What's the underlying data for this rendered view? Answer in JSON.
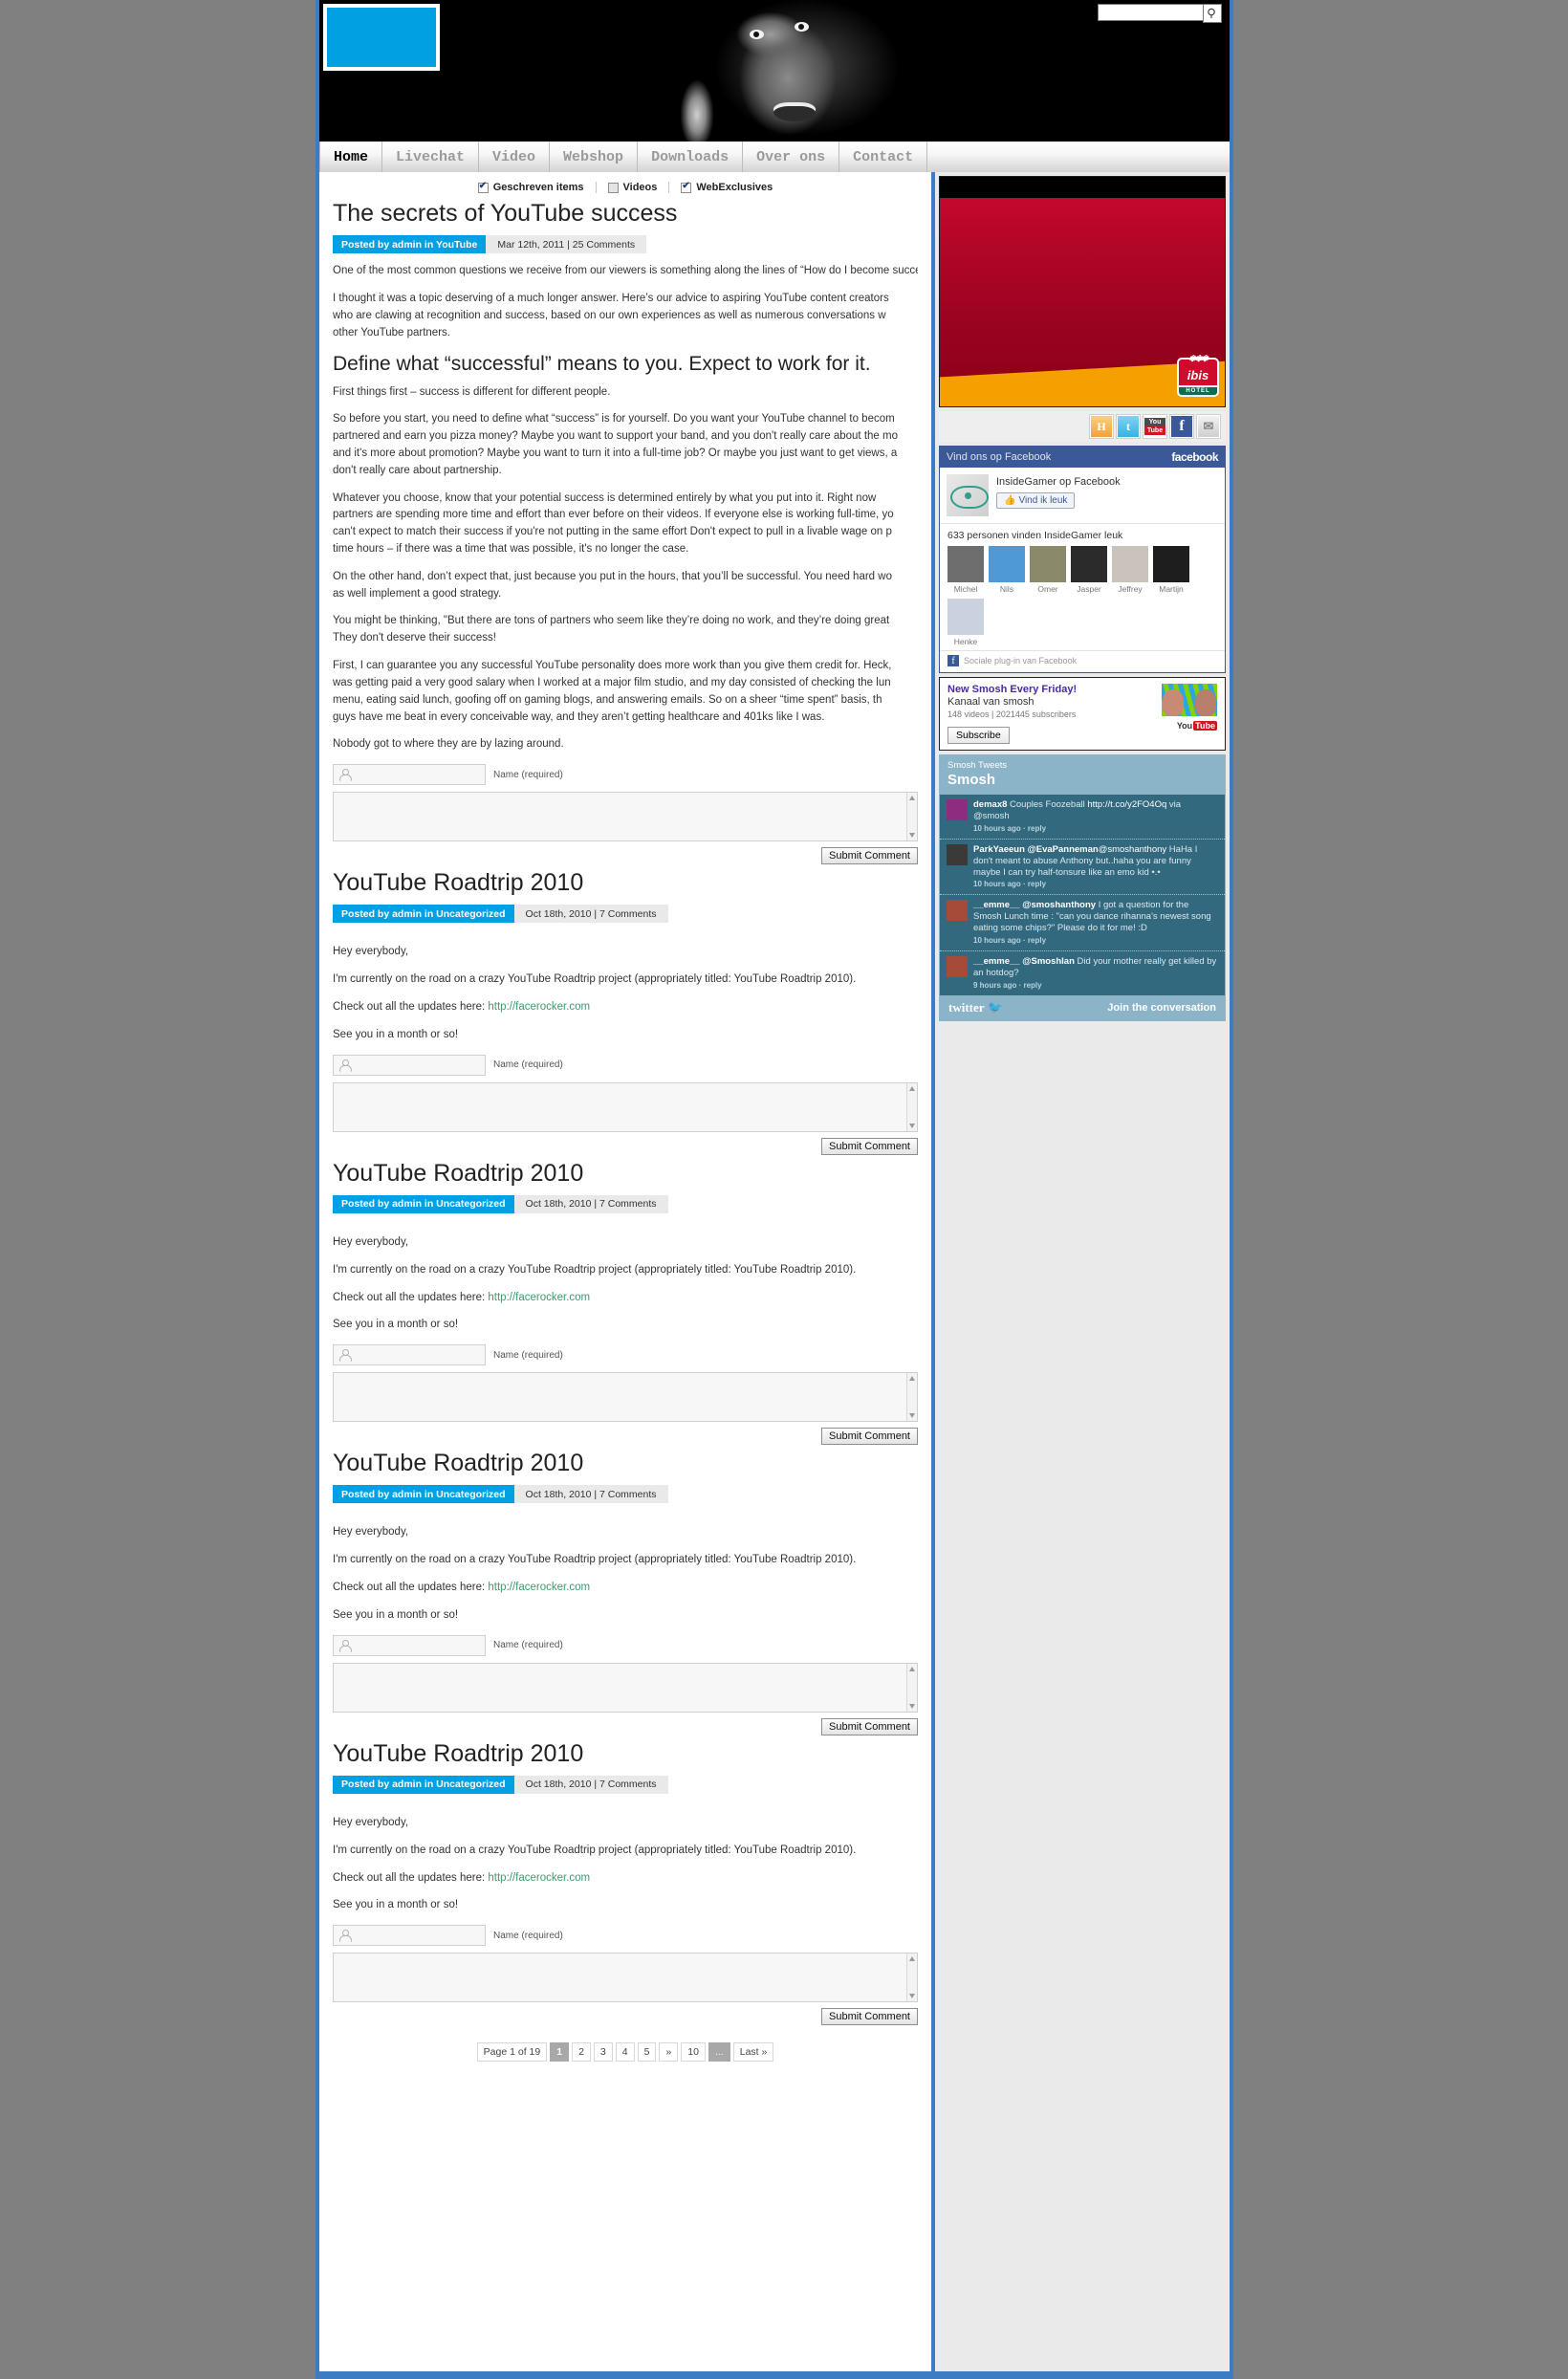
{
  "header": {
    "logo_alt": "site-logo",
    "search_placeholder": "",
    "search_value": "",
    "search_icon": "search-icon"
  },
  "nav": {
    "items": [
      {
        "label": "Home",
        "active": true
      },
      {
        "label": "Livechat",
        "active": false
      },
      {
        "label": "Video",
        "active": false
      },
      {
        "label": "Webshop",
        "active": false
      },
      {
        "label": "Downloads",
        "active": false
      },
      {
        "label": "Over ons",
        "active": false
      },
      {
        "label": "Contact",
        "active": false
      }
    ]
  },
  "filters": [
    {
      "label": "Geschreven items",
      "checked": true
    },
    {
      "label": "Videos",
      "checked": false
    },
    {
      "label": "WebExclusives",
      "checked": true
    }
  ],
  "posts": [
    {
      "title": "The secrets of YouTube success",
      "category": "Posted by admin in YouTube",
      "date": "Mar 12th, 2011 | 25 Comments",
      "p1": "One of the most common questions we receive from our viewers is something along the lines of “How do I become successful on YouTube?”",
      "p1b": "successful on YouTube?”",
      "p2": "I thought it was a topic deserving of a much longer answer. Here’s our advice to aspiring YouTube content creators",
      "p2b": "who are clawing at recognition and success, based on our own experiences as well as numerous conversations w",
      "p2c": "other YouTube partners.",
      "subhead": "Define what “successful” means to you. Expect to work for it.",
      "p3": "First things first – success is different for different people.",
      "p4a": "So before you start, you need to define what “success” is for yourself. Do you want your YouTube channel to becom",
      "p4b": "partnered and earn you pizza money? Maybe you want to support your band, and you don't really care about the mo",
      "p4c": "and it's more about promotion? Maybe you want to turn it into a full-time job? Or maybe you just want to get views, a",
      "p4d": "don't really care about partnership.",
      "p5a": "Whatever you choose, know that your potential success is determined entirely by what you put into it. Right now",
      "p5b": "partners are spending more time and effort than ever before on their videos. If everyone else is working full-time, yo",
      "p5c": "can't expect to match their success if you're not putting in the same effort Don't expect to pull in a livable wage on p",
      "p5d": "time hours – if there was a time that was possible, it's no longer the case.",
      "p6a": "On the other hand, don’t expect that, just because you put in the hours, that you’ll be successful. You need hard wo",
      "p6b": "as well implement a good strategy.",
      "p7a": "You might be thinking, \"But there are tons of partners who seem like they’re doing no work, and they’re doing great",
      "p7b": "They don't deserve their success!",
      "p8a": "First, I can guarantee you any successful YouTube personality does more work than you give them credit for. Heck,",
      "p8b": "was getting paid a very good salary when I worked at a major film studio, and my day consisted of checking the lun",
      "p8c": "menu, eating said lunch, goofing off on gaming blogs, and answering emails. So on a sheer “time spent” basis, th",
      "p8d": "guys have me beat in every conceivable way, and they aren’t getting healthcare and 401ks like I was.",
      "p9": "Nobody got to where they are by lazing around."
    },
    {
      "title": "YouTube Roadtrip 2010",
      "category": "Posted by admin in Uncategorized",
      "date": "Oct 18th, 2010 | 7 Comments",
      "l1": "Hey everybody,",
      "l2": "I'm currently on the road on a crazy YouTube Roadtrip project (appropriately titled: YouTube Roadtrip 2010).",
      "l3_pre": "Check out all the updates here: ",
      "l3_link": "http://facerocker.com",
      "l4": "See you in a month or so!"
    },
    {
      "title": "YouTube Roadtrip 2010",
      "category": "Posted by admin in Uncategorized",
      "date": "Oct 18th, 2010 | 7 Comments",
      "l1": "Hey everybody,",
      "l2": "I'm currently on the road on a crazy YouTube Roadtrip project (appropriately titled: YouTube Roadtrip 2010).",
      "l3_pre": "Check out all the updates here: ",
      "l3_link": "http://facerocker.com",
      "l4": "See you in a month or so!"
    },
    {
      "title": "YouTube Roadtrip 2010",
      "category": "Posted by admin in Uncategorized",
      "date": "Oct 18th, 2010 | 7 Comments",
      "l1": "Hey everybody,",
      "l2": "I'm currently on the road on a crazy YouTube Roadtrip project (appropriately titled: YouTube Roadtrip 2010).",
      "l3_pre": "Check out all the updates here: ",
      "l3_link": "http://facerocker.com",
      "l4": "See you in a month or so!"
    },
    {
      "title": "YouTube Roadtrip 2010",
      "category": "Posted by admin in Uncategorized",
      "date": "Oct 18th, 2010 | 7 Comments",
      "l1": "Hey everybody,",
      "l2": "I'm currently on the road on a crazy YouTube Roadtrip project (appropriately titled: YouTube Roadtrip 2010).",
      "l3_pre": "Check out all the updates here: ",
      "l3_link": "http://facerocker.com",
      "l4": "See you in a month or so!"
    }
  ],
  "comment_form": {
    "name_placeholder": "",
    "name_label": "Name (required)",
    "comment_value": "",
    "submit_label": "Submit Comment"
  },
  "pagination": {
    "label": "Page 1 of 19",
    "items": [
      "1",
      "2",
      "3",
      "4",
      "5",
      "»",
      "10",
      "...",
      "Last »"
    ],
    "active": "1"
  },
  "sidebar": {
    "ad": {
      "brand": "ibis",
      "sub": "HOTEL"
    },
    "social": [
      {
        "name": "hyves-icon",
        "glyph": "H"
      },
      {
        "name": "twitter-icon",
        "glyph": "t"
      },
      {
        "name": "youtube-icon",
        "glyph": "You Tube"
      },
      {
        "name": "facebook-icon",
        "glyph": "f"
      },
      {
        "name": "email-icon",
        "glyph": "✉"
      }
    ],
    "facebook": {
      "header": "Vind ons op Facebook",
      "logo": "facebook",
      "page_name": "InsideGamer",
      "page_suffix": " op Facebook",
      "like_label": "Vind ik leuk",
      "count_text": "633 personen vinden InsideGamer leuk",
      "people": [
        {
          "name": "Michel",
          "color": "#6e6e6e"
        },
        {
          "name": "Nils",
          "color": "#4f9ad6"
        },
        {
          "name": "Omer",
          "color": "#8a8a6a"
        },
        {
          "name": "Jasper",
          "color": "#2b2b2b"
        },
        {
          "name": "Jeffrey",
          "color": "#c9c3bb"
        },
        {
          "name": "Martijn",
          "color": "#1e1e1e"
        },
        {
          "name": "Henke",
          "color": "#c9d2de"
        }
      ],
      "footer": "Sociale plug-in van Facebook"
    },
    "youtube": {
      "title": "New Smosh Every Friday!",
      "channel": "Kanaal van smosh",
      "stats": "148 videos | 2021445 subscribers",
      "subscribe_label": "Subscribe",
      "logo_a": "You",
      "logo_b": "Tube"
    },
    "twitter": {
      "small": "Smosh Tweets",
      "big": "Smosh",
      "tweets": [
        {
          "user": "demax8",
          "text": " Couples Foozeball ",
          "link": "http://t.co/y2FO4Oq",
          "tail": " via @smosh",
          "ago": "10 hours ago · reply",
          "avatar_color": "#8e2c80"
        },
        {
          "user": "ParkYaeeun @EvaPanneman",
          "text": "",
          "link": "@smoshanthony",
          "tail": " HaHa I don't meant to abuse Anthony but..haha you are funny maybe I can try half-tonsure like an emo kid •.•",
          "ago": "10 hours ago · reply",
          "avatar_color": "#3c3a38"
        },
        {
          "user": "__emme__ @smoshanthony",
          "text": "",
          "link": "",
          "tail": " I got a question for the Smosh Lunch time : \"can you dance rihanna's newest song eating some chips?\" Please do it for me! :D",
          "ago": "10 hours ago · reply",
          "avatar_color": "#a64b3a"
        },
        {
          "user": "__emme__ @SmoshIan",
          "text": "",
          "link": "",
          "tail": " Did your mother really get killed by an hotdog?",
          "ago": "9 hours ago · reply",
          "avatar_color": "#a64b3a"
        }
      ],
      "brand": "twitter",
      "join": "Join the conversation"
    }
  }
}
